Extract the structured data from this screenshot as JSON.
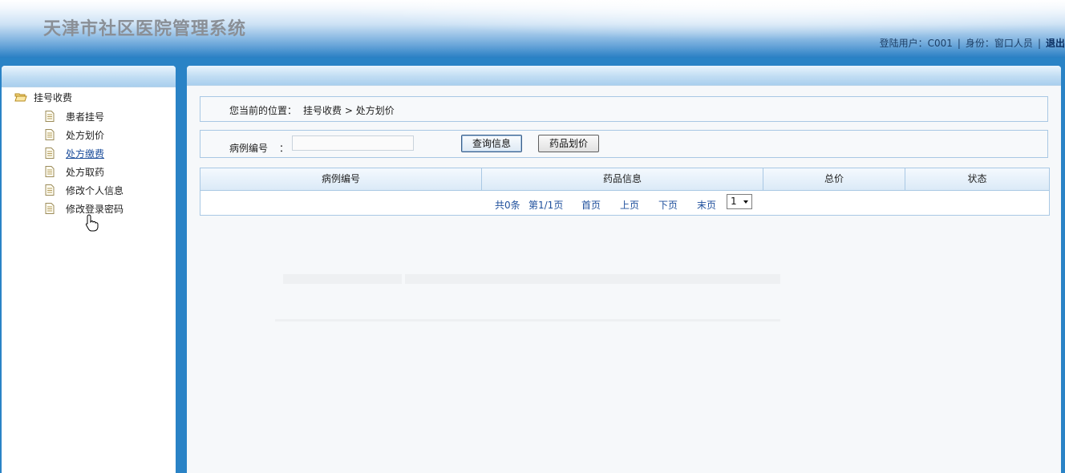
{
  "header": {
    "app_title": "天津市社区医院管理系统",
    "user_label": "登陆用户：C001",
    "role_label": "身份：窗口人员",
    "separator": "|",
    "logout_label": "退出"
  },
  "sidebar": {
    "root": {
      "label": "挂号收费",
      "icon": "folder-open-icon"
    },
    "items": [
      {
        "label": "患者挂号",
        "icon": "document-icon"
      },
      {
        "label": "处方划价",
        "icon": "document-icon"
      },
      {
        "label": "处方缴费",
        "icon": "document-icon",
        "hovered": true
      },
      {
        "label": "处方取药",
        "icon": "document-icon"
      },
      {
        "label": "修改个人信息",
        "icon": "document-icon"
      },
      {
        "label": "修改登录密码",
        "icon": "document-icon"
      }
    ]
  },
  "breadcrumb": {
    "prefix": "您当前的位置：",
    "path": "挂号收费 > 处方划价"
  },
  "search": {
    "label": "病例编号",
    "colon": "：",
    "value": "",
    "query_button": "查询信息",
    "price_button": "药品划价"
  },
  "table": {
    "columns": [
      "病例编号",
      "药品信息",
      "总价",
      "状态"
    ],
    "rows": []
  },
  "pager": {
    "total": "共0条",
    "page_info": "第1/1页",
    "first": "首页",
    "prev": "上页",
    "next": "下页",
    "last": "末页",
    "selected_page": "1"
  },
  "colors": {
    "background_blue": "#2a83c6",
    "link_blue": "#1e4f9c",
    "border_blue": "#a9c8e4"
  }
}
